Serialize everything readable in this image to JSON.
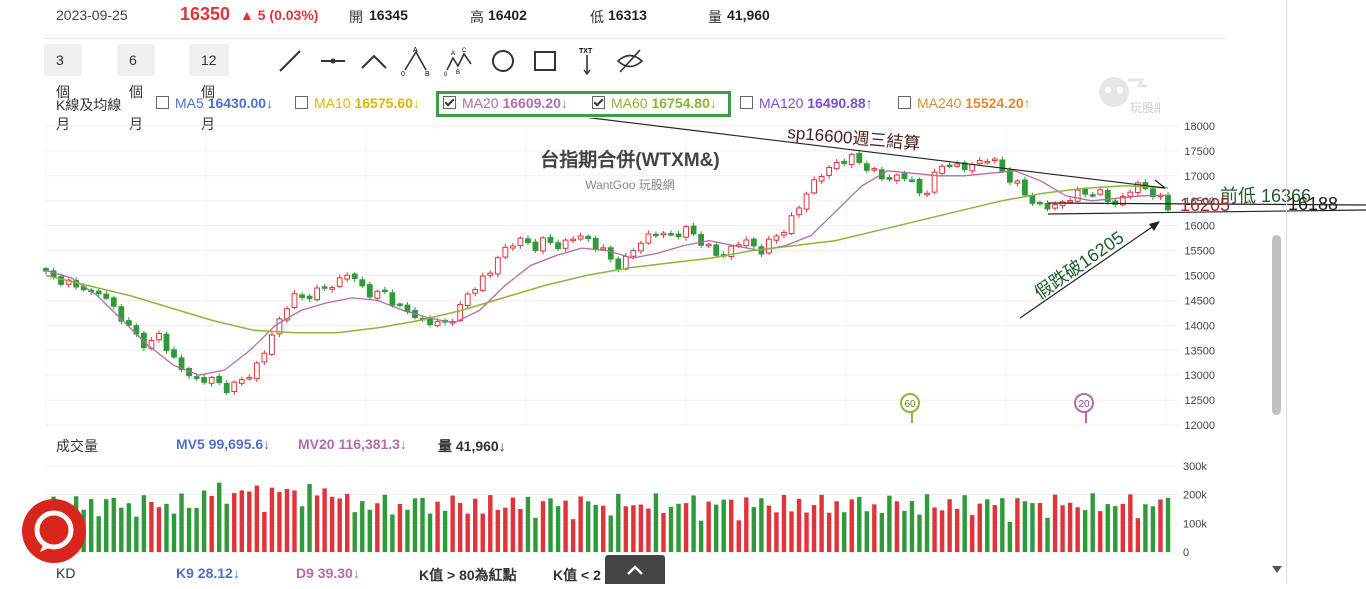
{
  "header": {
    "date": "2023-09-25",
    "price": "16350",
    "change": "▲ 5 (0.03%)",
    "open_label": "開",
    "open": "16345",
    "high_label": "高",
    "high": "16402",
    "low_label": "低",
    "low": "16313",
    "vol_label": "量",
    "vol": "41,960"
  },
  "toolbar": {
    "ranges": [
      "3 個月",
      "6 個月",
      "12 個月"
    ],
    "tools": [
      "line-tool-icon",
      "horizontal-line-icon",
      "angle-line-icon",
      "abc-pattern-icon",
      "abcde-wave-icon",
      "circle-tool-icon",
      "rectangle-tool-icon",
      "text-tool-icon",
      "hide-drawings-icon"
    ],
    "tool_text": {
      "a": "A",
      "b": "B",
      "c": "C",
      "o": "0",
      "txt": "TXT"
    }
  },
  "ma_legend": {
    "title": "K線及均線",
    "items": [
      {
        "name": "MA5",
        "value": "16430.00↓",
        "checked": false,
        "color": "#4f6fc9"
      },
      {
        "name": "MA10",
        "value": "16575.60↓",
        "checked": false,
        "color": "#e1b400"
      },
      {
        "name": "MA20",
        "value": "16609.20↓",
        "checked": true,
        "color": "#b46ba6"
      },
      {
        "name": "MA60",
        "value": "16754.80↓",
        "checked": true,
        "color": "#8db53a"
      },
      {
        "name": "MA120",
        "value": "16490.88↑",
        "checked": false,
        "color": "#7b4fc9"
      },
      {
        "name": "MA240",
        "value": "15524.20↑",
        "checked": false,
        "color": "#e08a2e"
      }
    ]
  },
  "chart_data": {
    "type": "candlestick",
    "title": "台指期合併(WTXM&)",
    "subtitle": "WantGoo 玩股網",
    "watermark": "玩股網",
    "y_ticks": [
      18000,
      17500,
      17000,
      16500,
      16000,
      15500,
      15000,
      14500,
      14000,
      13500,
      13000,
      12500,
      12000
    ],
    "ylim": [
      12000,
      18000
    ],
    "close_path": [
      15050,
      14900,
      14950,
      14700,
      14800,
      14600,
      14650,
      14400,
      14150,
      13900,
      13700,
      13600,
      13800,
      13500,
      13200,
      13000,
      12900,
      12950,
      12850,
      12750,
      12800,
      12900,
      13100,
      13400,
      13800,
      14200,
      14600,
      14500,
      14650,
      14700,
      14750,
      14900,
      15050,
      14850,
      14700,
      14600,
      14650,
      14450,
      14300,
      14200,
      14100,
      14050,
      14000,
      14150,
      14350,
      14700,
      14900,
      15000,
      15400,
      15600,
      15700,
      15650,
      15600,
      15700,
      15600,
      15650,
      15750,
      15800,
      15650,
      15500,
      15300,
      15200,
      15400,
      15700,
      15800,
      15850,
      15800,
      15850,
      15900,
      15800,
      15600,
      15400,
      15450,
      15600,
      15700,
      15600,
      15500,
      15700,
      15900,
      16100,
      16400,
      16800,
      17000,
      17100,
      17300,
      17350,
      17300,
      17200,
      17050,
      16900,
      17000,
      17000,
      16800,
      16600,
      16900,
      17200,
      17300,
      17100,
      17200,
      17300,
      17350,
      17200,
      17000,
      16800,
      16600,
      16450,
      16350,
      16400,
      16500,
      16600,
      16650,
      16700,
      16600,
      16450,
      16500,
      16700,
      16850,
      16700,
      16550,
      16350
    ],
    "ma20": [
      15100,
      14950,
      14600,
      14100,
      13600,
      13200,
      13000,
      13100,
      13500,
      14000,
      14300,
      14450,
      14550,
      14500,
      14300,
      14150,
      14050,
      14300,
      14800,
      15200,
      15400,
      15550,
      15500,
      15350,
      15450,
      15600,
      15700,
      15600,
      15500,
      15600,
      15800,
      16300,
      16800,
      17100,
      17050,
      17000,
      17000,
      17050,
      17100,
      16900,
      16600,
      16500,
      16550,
      16600,
      16609
    ],
    "ma60": [
      15000,
      14800,
      14600,
      14350,
      14100,
      13900,
      13850,
      13850,
      13950,
      14100,
      14300,
      14550,
      14800,
      15000,
      15150,
      15250,
      15350,
      15500,
      15600,
      15700,
      15900,
      16100,
      16300,
      16500,
      16650,
      16750,
      16800,
      16755
    ],
    "annotations": {
      "sp_note": "sp16600週三結算",
      "prev_low": "前低 16366",
      "level_a": "16205",
      "level_b": "16188",
      "fake_break": "假跌破16205",
      "marker_60": "60",
      "marker_20": "20"
    }
  },
  "volume": {
    "label": "成交量",
    "mv5": "MV5 99,695.6↓",
    "mv20": "MV20 116,381.3↓",
    "vol": "量 41,960↓",
    "y_ticks": [
      "300k",
      "200k",
      "100k",
      "0"
    ]
  },
  "kd": {
    "label": "KD",
    "k9": "K9 28.12↓",
    "d9": "D9 39.30↓",
    "note1": "K值 > 80為紅點",
    "note2": "K值 < 2"
  },
  "colors": {
    "up": "#e0343a",
    "down": "#2e9a3a",
    "ma20": "#b46ba6",
    "ma60": "#8db53a",
    "annot": "#1f5c2c",
    "level": "#a12a2a"
  }
}
